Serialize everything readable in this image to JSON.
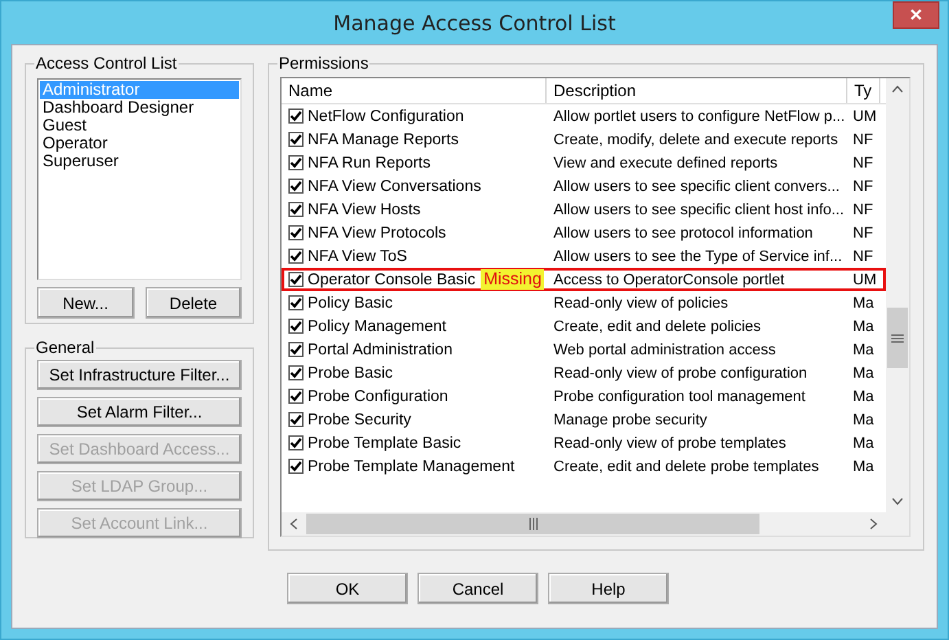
{
  "window": {
    "title": "Manage Access Control List",
    "close": "✕"
  },
  "access_control_list": {
    "title": "Access Control List",
    "items": [
      {
        "label": "Administrator",
        "selected": true
      },
      {
        "label": "Dashboard Designer",
        "selected": false
      },
      {
        "label": "Guest",
        "selected": false
      },
      {
        "label": "Operator",
        "selected": false
      },
      {
        "label": "Superuser",
        "selected": false
      }
    ],
    "buttons": [
      "New...",
      "Delete"
    ]
  },
  "general": {
    "title": "General",
    "buttons": [
      {
        "label": "Set Infrastructure Filter...",
        "disabled": false
      },
      {
        "label": "Set Alarm Filter...",
        "disabled": false
      },
      {
        "label": "Set Dashboard Access...",
        "disabled": true
      },
      {
        "label": "Set LDAP Group...",
        "disabled": true
      },
      {
        "label": "Set Account Link...",
        "disabled": true
      }
    ]
  },
  "permissions": {
    "title": "Permissions",
    "columns": [
      "Name",
      "Description",
      "Ty"
    ],
    "rows": [
      {
        "checked": true,
        "name": "NetFlow Configuration",
        "description": "Allow portlet users to configure NetFlow p...",
        "type": "UM",
        "highlighted": false
      },
      {
        "checked": true,
        "name": "NFA Manage Reports",
        "description": "Create, modify, delete and execute reports",
        "type": "NF",
        "highlighted": false
      },
      {
        "checked": true,
        "name": "NFA Run Reports",
        "description": "View and execute defined reports",
        "type": "NF",
        "highlighted": false
      },
      {
        "checked": true,
        "name": "NFA View Conversations",
        "description": "Allow users to see specific client convers...",
        "type": "NF",
        "highlighted": false
      },
      {
        "checked": true,
        "name": "NFA View Hosts",
        "description": "Allow users to see specific client host info...",
        "type": "NF",
        "highlighted": false
      },
      {
        "checked": true,
        "name": "NFA View Protocols",
        "description": "Allow users to see protocol information",
        "type": "NF",
        "highlighted": false
      },
      {
        "checked": true,
        "name": "NFA View ToS",
        "description": "Allow users to see the Type of Service inf...",
        "type": "NF",
        "highlighted": false
      },
      {
        "checked": true,
        "name": "Operator Console Basic",
        "annotation": "Missing",
        "description": "Access to OperatorConsole portlet",
        "type": "UM",
        "highlighted": true
      },
      {
        "checked": true,
        "name": "Policy Basic",
        "description": "Read-only view of policies",
        "type": "Ma",
        "highlighted": false
      },
      {
        "checked": true,
        "name": "Policy Management",
        "description": "Create, edit and delete policies",
        "type": "Ma",
        "highlighted": false
      },
      {
        "checked": true,
        "name": "Portal Administration",
        "description": "Web portal administration access",
        "type": "Ma",
        "highlighted": false
      },
      {
        "checked": true,
        "name": "Probe Basic",
        "description": "Read-only view of probe configuration",
        "type": "Ma",
        "highlighted": false
      },
      {
        "checked": true,
        "name": "Probe Configuration",
        "description": "Probe configuration tool management",
        "type": "Ma",
        "highlighted": false
      },
      {
        "checked": true,
        "name": "Probe Security",
        "description": "Manage probe security",
        "type": "Ma",
        "highlighted": false
      },
      {
        "checked": true,
        "name": "Probe Template Basic",
        "description": "Read-only view of probe templates",
        "type": "Ma",
        "highlighted": false
      },
      {
        "checked": true,
        "name": "Probe Template Management",
        "description": "Create, edit and delete probe templates",
        "type": "Ma",
        "highlighted": false
      }
    ]
  },
  "footer_buttons": [
    "OK",
    "Cancel",
    "Help"
  ]
}
